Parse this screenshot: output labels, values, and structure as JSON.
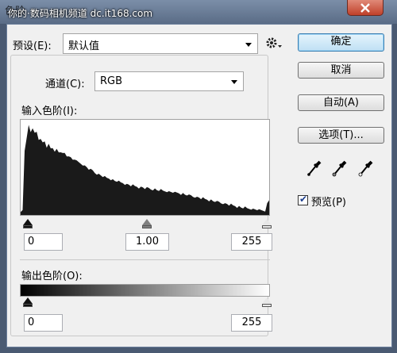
{
  "window": {
    "title": "色阶",
    "watermark": "你的·数码相机频道 dc.it168.com",
    "close_icon": "close-icon"
  },
  "preset": {
    "label": "预设(E):",
    "value": "默认值",
    "options_icon": "gear-icon"
  },
  "channel": {
    "label": "通道(C):",
    "value": "RGB"
  },
  "input_levels": {
    "label": "输入色阶(I):",
    "black": "0",
    "gamma": "1.00",
    "white": "255"
  },
  "output_levels": {
    "label": "输出色阶(O):",
    "black": "0",
    "white": "255"
  },
  "buttons": {
    "ok": "确定",
    "cancel": "取消",
    "auto": "自动(A)",
    "options": "选项(T)..."
  },
  "eyedroppers": [
    "black-eyedropper-icon",
    "gray-eyedropper-icon",
    "white-eyedropper-icon"
  ],
  "preview": {
    "label": "预览(P)",
    "checked": true
  },
  "histogram": [
    0.02,
    0.05,
    0.7,
    0.85,
    0.97,
    0.9,
    0.95,
    0.88,
    0.9,
    0.82,
    0.84,
    0.78,
    0.8,
    0.74,
    0.76,
    0.72,
    0.73,
    0.7,
    0.71,
    0.68,
    0.69,
    0.66,
    0.67,
    0.64,
    0.65,
    0.62,
    0.6,
    0.61,
    0.58,
    0.57,
    0.56,
    0.55,
    0.53,
    0.52,
    0.5,
    0.49,
    0.48,
    0.46,
    0.45,
    0.44,
    0.43,
    0.42,
    0.41,
    0.4,
    0.4,
    0.39,
    0.38,
    0.37,
    0.37,
    0.36,
    0.35,
    0.35,
    0.34,
    0.33,
    0.33,
    0.32,
    0.32,
    0.31,
    0.31,
    0.3,
    0.3,
    0.3,
    0.29,
    0.29,
    0.29,
    0.28,
    0.28,
    0.28,
    0.27,
    0.27,
    0.27,
    0.26,
    0.26,
    0.26,
    0.25,
    0.25,
    0.25,
    0.24,
    0.24,
    0.24,
    0.23,
    0.23,
    0.22,
    0.22,
    0.21,
    0.21,
    0.2,
    0.2,
    0.19,
    0.19,
    0.18,
    0.18,
    0.17,
    0.17,
    0.16,
    0.16,
    0.15,
    0.15,
    0.14,
    0.14,
    0.13,
    0.13,
    0.12,
    0.12,
    0.11,
    0.11,
    0.1,
    0.1,
    0.09,
    0.09,
    0.08,
    0.08,
    0.08,
    0.07,
    0.07,
    0.07,
    0.06,
    0.06,
    0.06,
    0.05,
    0.05,
    0.05,
    0.05,
    0.12,
    0.16
  ]
}
